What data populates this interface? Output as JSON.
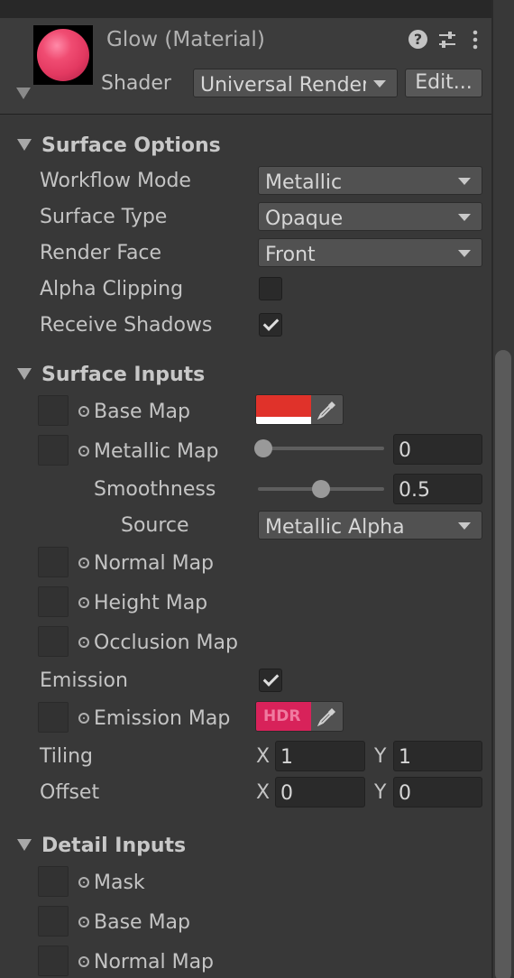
{
  "header": {
    "title": "Glow (Material)",
    "shader_label": "Shader",
    "shader_value": "Universal Render Pipeline/Lit",
    "edit_label": "Edit...",
    "preview_color": "#e8406a"
  },
  "surface_options": {
    "title": "Surface Options",
    "workflow_label": "Workflow Mode",
    "workflow_value": "Metallic",
    "surface_type_label": "Surface Type",
    "surface_type_value": "Opaque",
    "render_face_label": "Render Face",
    "render_face_value": "Front",
    "alpha_clipping_label": "Alpha Clipping",
    "alpha_clipping_checked": false,
    "receive_shadows_label": "Receive Shadows",
    "receive_shadows_checked": true
  },
  "surface_inputs": {
    "title": "Surface Inputs",
    "base_map_label": "Base Map",
    "base_color": "#e0322a",
    "metallic_label": "Metallic Map",
    "metallic_value": "0",
    "metallic_fraction": 0,
    "smoothness_label": "Smoothness",
    "smoothness_value": "0.5",
    "smoothness_fraction": 0.5,
    "source_label": "Source",
    "source_value": "Metallic Alpha",
    "normal_map_label": "Normal Map",
    "height_map_label": "Height Map",
    "occlusion_map_label": "Occlusion Map",
    "emission_label": "Emission",
    "emission_checked": true,
    "emission_map_label": "Emission Map",
    "emission_hdr_label": "HDR",
    "emission_color": "#d8225a",
    "tiling_label": "Tiling",
    "tiling_x_label": "X",
    "tiling_x": "1",
    "tiling_y_label": "Y",
    "tiling_y": "1",
    "offset_label": "Offset",
    "offset_x_label": "X",
    "offset_x": "0",
    "offset_y_label": "Y",
    "offset_y": "0"
  },
  "detail_inputs": {
    "title": "Detail Inputs",
    "mask_label": "Mask",
    "base_map_label": "Base Map",
    "normal_map_label": "Normal Map"
  }
}
